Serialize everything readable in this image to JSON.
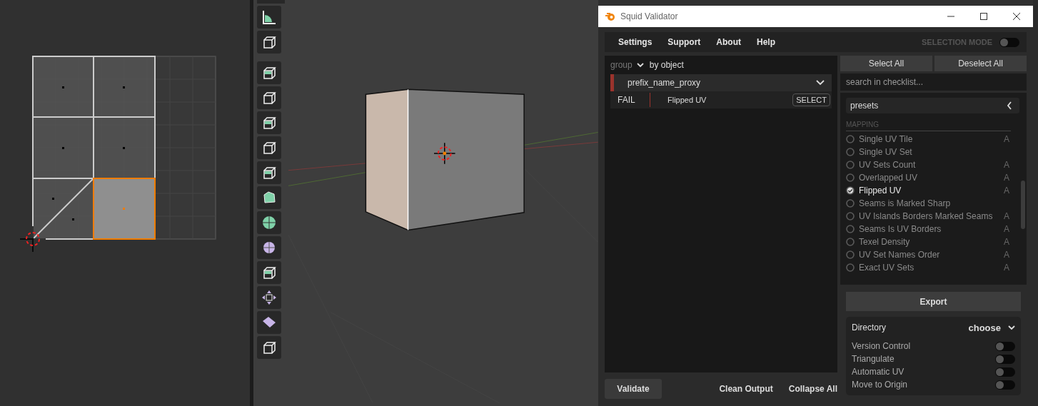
{
  "window": {
    "title": "Squid Validator"
  },
  "menu": [
    "Settings",
    "Support",
    "About",
    "Help"
  ],
  "selection_mode": {
    "label": "SELECTION MODE",
    "on": false
  },
  "output": {
    "group_label": "group",
    "group_value": "by object",
    "groups": [
      {
        "name": "prefix_name_proxy",
        "expanded": true,
        "results": [
          {
            "status": "FAIL",
            "check": "Flipped UV",
            "action": "SELECT"
          }
        ]
      }
    ]
  },
  "bottom_buttons": {
    "validate": "Validate",
    "clean": "Clean Output",
    "collapse": "Collapse All"
  },
  "checklist": {
    "select_all": "Select All",
    "deselect_all": "Deselect All",
    "search_placeholder": "search in checklist...",
    "presets": "presets",
    "section": "MAPPING",
    "items": [
      {
        "label": "Single UV Tile",
        "checked": false,
        "badge": "A"
      },
      {
        "label": "Single UV Set",
        "checked": false
      },
      {
        "label": "UV Sets Count",
        "checked": false,
        "badge": "A"
      },
      {
        "label": "Overlapped UV",
        "checked": false,
        "badge": "A"
      },
      {
        "label": "Flipped UV",
        "checked": true,
        "badge": "A"
      },
      {
        "label": "Seams is Marked Sharp",
        "checked": false
      },
      {
        "label": "UV Islands Borders Marked Seams",
        "checked": false,
        "badge": "A"
      },
      {
        "label": "Seams Is UV Borders",
        "checked": false,
        "badge": "A"
      },
      {
        "label": "Texel Density",
        "checked": false,
        "badge": "A"
      },
      {
        "label": "UV Set Names Order",
        "checked": false,
        "badge": "A"
      },
      {
        "label": "Exact UV Sets",
        "checked": false,
        "badge": "A"
      }
    ]
  },
  "export": {
    "button": "Export",
    "directory_label": "Directory",
    "directory_value": "choose",
    "options": [
      {
        "label": "Version Control",
        "on": false
      },
      {
        "label": "Triangulate",
        "on": false
      },
      {
        "label": "Automatic UV",
        "on": false
      },
      {
        "label": "Move to Origin",
        "on": false
      }
    ]
  }
}
